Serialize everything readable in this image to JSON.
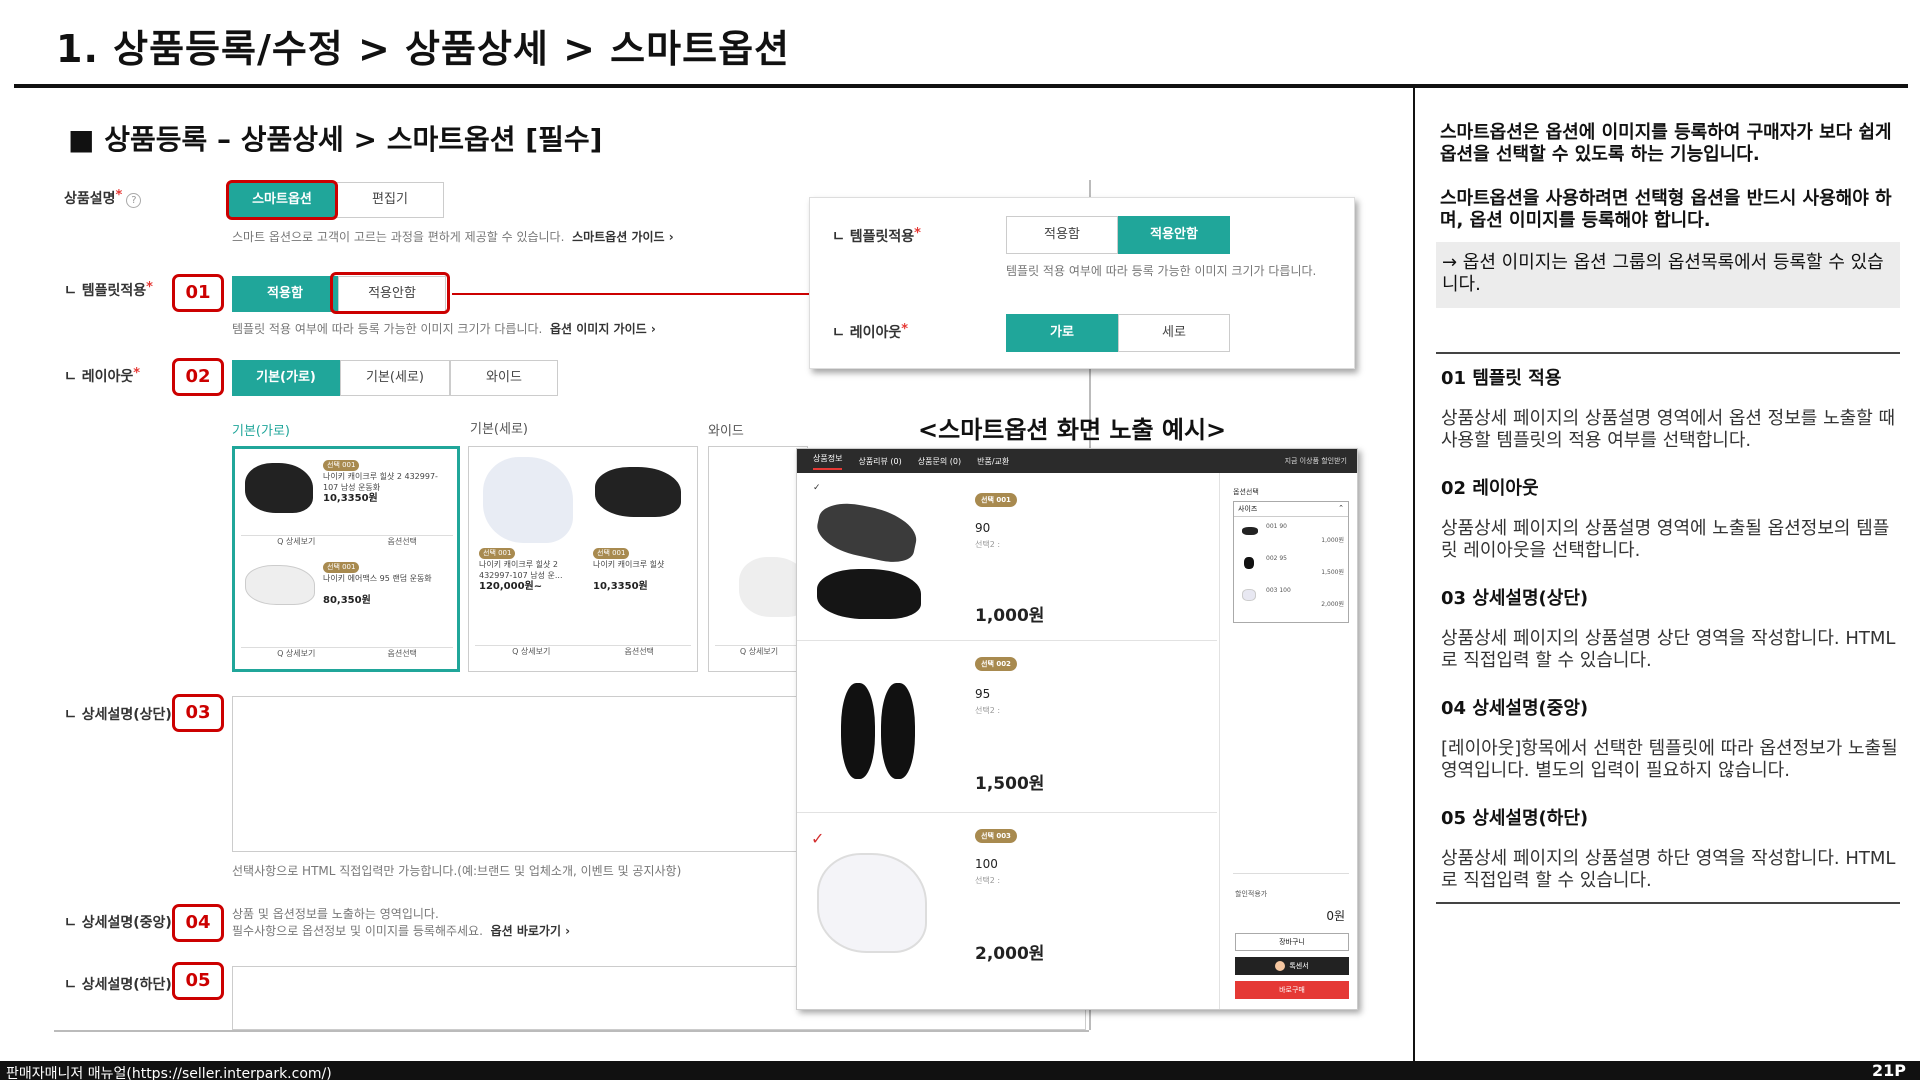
{
  "page_title": "1. 상품등록/수정 > 상품상세 > 스마트옵션",
  "section_heading": "■ 상품등록 – 상품상세 > 스마트옵션 [필수]",
  "form": {
    "desc_label": "상품설명",
    "desc_tabs": [
      "스마트옵션",
      "편집기"
    ],
    "desc_help": "스마트 옵션으로 고객이 고르는 과정을 편하게 제공할 수 있습니다.",
    "desc_link": "스마트옵션 가이드 ›",
    "template_label": "ㄴ 템플릿적용",
    "template_tabs": [
      "적용함",
      "적용안함"
    ],
    "template_help": "템플릿 적용 여부에 따라 등록 가능한 이미지 크기가 다릅니다.",
    "template_link": "옵션 이미지 가이드 ›",
    "layout_label": "ㄴ 레이아웃",
    "layout_tabs": [
      "기본(가로)",
      "기본(세로)",
      "와이드"
    ],
    "layout_previews": [
      "기본(가로)",
      "기본(세로)",
      "와이드"
    ],
    "top_label": "ㄴ 상세설명(상단)",
    "top_help": "선택사항으로 HTML 직접입력만 가능합니다.(예:브랜드 및 업체소개, 이벤트 및 공지사항)",
    "mid_label": "ㄴ 상세설명(중앙)",
    "mid_help1": "상품 및 옵션정보를 노출하는 영역입니다.",
    "mid_help2": "필수사항으로 옵션정보 및 이미지를 등록해주세요.",
    "mid_link": "옵션 바로가기 ›",
    "bottom_label": "ㄴ 상세설명(하단)",
    "numbers": [
      "01",
      "02",
      "03",
      "04",
      "05"
    ],
    "cards": {
      "h1_name": "나이키 캐이크루 힐샷 2 432997-107 남성 운동화",
      "h1_price": "10,3350원",
      "h2_name": "나이키 에어맥스 95 랜덤 운동화",
      "h2_price": "80,350원",
      "v1_name": "나이키 캐이크루 힐샷 2 432997-107 남성 운...",
      "v1_price": "120,000원~",
      "v2_name": "나이키 캐이크루 힐샷",
      "v2_price": "10,3350원",
      "badge": "선택 001",
      "btn_detail": "Q 상세보기",
      "btn_option": "옵션선택"
    }
  },
  "popup": {
    "template_label": "ㄴ 템플릿적용",
    "template_tabs": [
      "적용함",
      "적용안함"
    ],
    "template_help": "템플릿 적용 여부에 따라 등록 가능한 이미지 크기가 다릅니다.",
    "layout_label": "ㄴ 레이아웃",
    "layout_tabs": [
      "가로",
      "세로"
    ]
  },
  "example": {
    "caption": "<스마트옵션 화면 노출 예시>",
    "nav": [
      "상품정보",
      "상품리뷰 (0)",
      "상품문의 (0)",
      "반품/교환"
    ],
    "nav_right": "지금 이상품 할인받기",
    "items": [
      {
        "badge": "선택 001",
        "size": "90",
        "sub": "선택2 :",
        "price": "1,000원"
      },
      {
        "badge": "선택 002",
        "size": "95",
        "sub": "선택2 :",
        "price": "1,500원"
      },
      {
        "badge": "선택 003",
        "size": "100",
        "sub": "선택2 :",
        "price": "2,000원"
      }
    ],
    "side": {
      "title": "옵션선택",
      "select": "사이즈",
      "opts": [
        {
          "name": "001 90",
          "price": "1,000원"
        },
        {
          "name": "002 95",
          "price": "1,500원"
        },
        {
          "name": "003 100",
          "price": "2,000원"
        }
      ],
      "discount_label": "할인적용가",
      "total": "0원",
      "cart": "장바구니",
      "talk": "톡센서",
      "buy": "바로구매"
    }
  },
  "right": {
    "intro1": "스마트옵션은 옵션에 이미지를 등록하여 구매자가 보다 쉽게 옵션을 선택할 수 있도록 하는 기능입니다.",
    "intro2": "스마트옵션을 사용하려면 선택형 옵션을 반드시 사용해야 하며, 옵션 이미지를 등록해야 합니다.",
    "note": "→ 옵션 이미지는 옵션 그룹의 옵션목록에서 등록할 수 있습니다.",
    "sections": [
      {
        "h": "01 템플릿 적용",
        "p": "상품상세 페이지의 상품설명 영역에서 옵션 정보를 노출할 때 사용할 템플릿의 적용 여부를 선택합니다."
      },
      {
        "h": "02 레이아웃",
        "p": "상품상세 페이지의 상품설명 영역에 노출될 옵션정보의 템플릿 레이아웃을 선택합니다."
      },
      {
        "h": "03 상세설명(상단)",
        "p": "상품상세 페이지의 상품설명 상단 영역을 작성합니다. HTML로 직접입력 할 수 있습니다."
      },
      {
        "h": "04 상세설명(중앙)",
        "p": "[레이아웃]항목에서 선택한 템플릿에 따라 옵션정보가 노출될 영역입니다. 별도의 입력이 필요하지 않습니다."
      },
      {
        "h": "05 상세설명(하단)",
        "p": "상품상세 페이지의 상품설명 하단 영역을 작성합니다. HTML 로 직접입력 할 수 있습니다."
      }
    ]
  },
  "footer": {
    "text": "판매자매니저 매뉴얼(https://seller.interpark.com/)",
    "page": "21P"
  },
  "colors": {
    "accent": "#20a69a",
    "highlight": "#cc0000",
    "badge": "#a88a4f"
  }
}
